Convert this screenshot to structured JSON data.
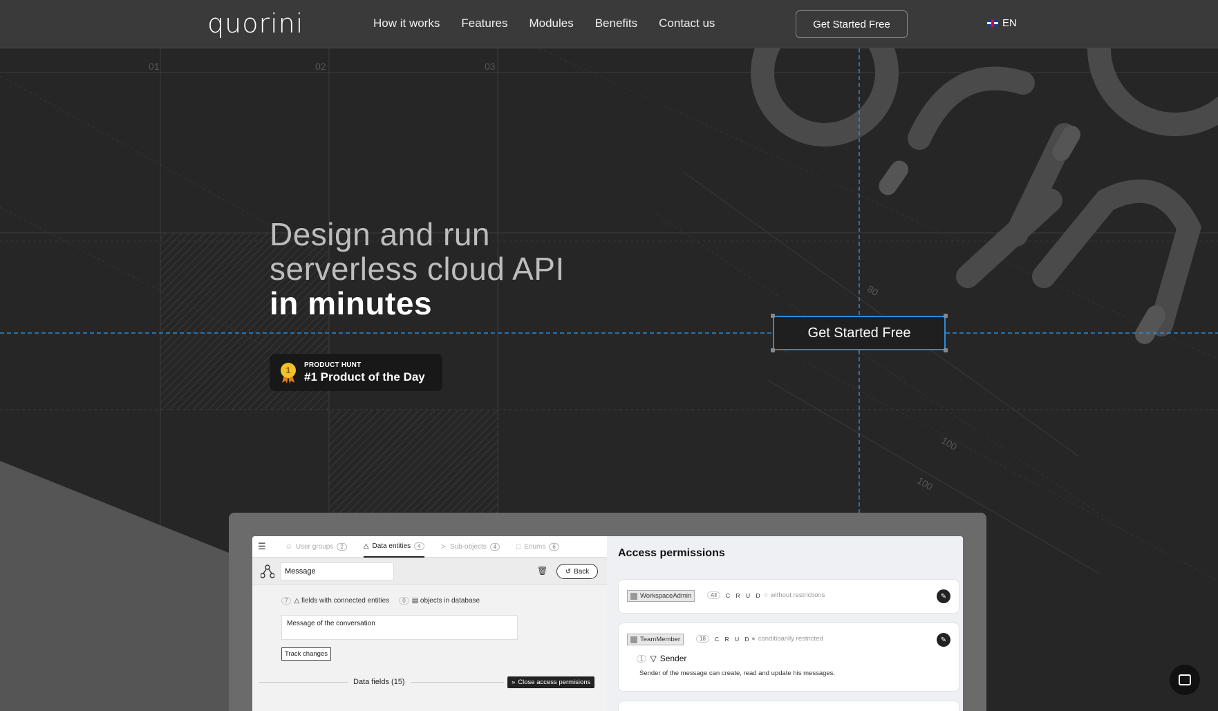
{
  "nav": {
    "logo": "quorini",
    "links": [
      "How it works",
      "Features",
      "Modules",
      "Benefits",
      "Contact us"
    ],
    "cta": "Get Started Free",
    "lang": "EN"
  },
  "grid": {
    "col1": "01",
    "col2": "02",
    "col3": "03",
    "dim1": "80",
    "dim2": "100",
    "dim3": "100"
  },
  "hero": {
    "line1": "Design and run",
    "line2": "serverless cloud API",
    "line3": "in minutes",
    "badge_small": "PRODUCT HUNT",
    "badge_main": "#1 Product of the Day",
    "badge_rank": "1",
    "cta": "Get Started Free"
  },
  "app": {
    "tabs": [
      {
        "label": "User groups",
        "count": "2"
      },
      {
        "label": "Data entities",
        "count": "4"
      },
      {
        "label": "Sub-objects",
        "count": "4"
      },
      {
        "label": "Enums",
        "count": "6"
      }
    ],
    "entity_name": "Message",
    "back": "Back",
    "fields_count": "7",
    "fields_label": "fields with connected entities",
    "objects_count": "0",
    "objects_label": "objects in database",
    "description": "Message of the conversation",
    "track": "Track changes",
    "data_fields": "Data fields (15)",
    "close_access": "Close access permisions",
    "permissions_title": "Access permissions",
    "permissions": [
      {
        "role": "WorkspaceAdmin",
        "count": "All",
        "crud": "C R U D",
        "restriction": "without restrictions"
      },
      {
        "role": "TeamMember",
        "count": "18",
        "crud": "C R U D",
        "restriction": "conditioanlly restricted",
        "rule_count": "1",
        "rule_name": "Sender",
        "rule_desc": "Sender of the message can create, read and update his messages."
      }
    ]
  },
  "colors": {
    "accent_blue": "#2c8bd6",
    "bg": "#262626",
    "nav": "#3a3a3a"
  }
}
